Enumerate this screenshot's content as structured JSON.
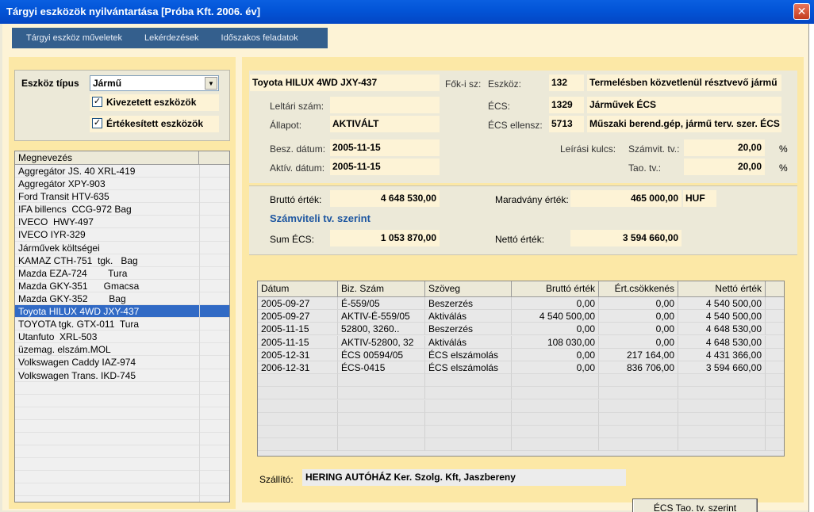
{
  "window": {
    "title": "Tárgyi eszközök nyilvántartása   [Próba Kft.    2006. év]"
  },
  "menu": [
    "Tárgyi eszköz műveletek",
    "Lekérdezések",
    "Időszakos feladatok"
  ],
  "filter": {
    "type_label": "Eszköz típus",
    "type_value": "Jármű",
    "check1_label": "Kivezetett eszközök",
    "check1_checked": true,
    "check2_label": "Értékesített eszközök",
    "check2_checked": true
  },
  "assets": {
    "header": "Megnevezés",
    "items": [
      "Aggregátor JS. 40 XRL-419",
      "Aggregátor XPY-903",
      "Ford Transit HTV-635",
      "IFA billencs  CCG-972 Bag",
      "IVECO  HWY-497",
      "IVECO IYR-329",
      "Járművek költségei",
      "KAMAZ CTH-751  tgk.   Bag",
      "Mazda EZA-724        Tura",
      "Mazda GKY-351      Gmacsa",
      "Mazda GKY-352        Bag",
      "Toyota HILUX 4WD JXY-437",
      "TOYOTA tgk. GTX-011  Tura",
      "Utanfuto  XRL-503",
      "üzemag. elszám.MOL",
      "Volkswagen Caddy IAZ-974",
      "Volkswagen Trans. IKD-745"
    ],
    "selected_index": 11
  },
  "detail": {
    "name": "Toyota HILUX 4WD JXY-437",
    "fokisz_label": "Fők-i sz:",
    "eszkoz_label": "Eszköz:",
    "eszkoz_code": "132",
    "eszkoz_text": "Termelésben közvetlenül résztvevő jármű",
    "leltari_label": "Leltári szám:",
    "leltari_value": "",
    "ecs_label": "ÉCS:",
    "ecs_code": "1329",
    "ecs_text": "Járművek ÉCS",
    "allapot_label": "Állapot:",
    "allapot_value": "AKTIVÁLT",
    "ecs_ellensz_label": "ÉCS ellensz:",
    "ecs_ellensz_code": "5713",
    "ecs_ellensz_text": "Műszaki berend.gép, jármű terv. szer. ÉCS",
    "besz_label": "Besz. dátum:",
    "besz_value": "2005-11-15",
    "aktiv_label": "Aktív. dátum:",
    "aktiv_value": "2005-11-15",
    "leirasi_label": "Leírási kulcs:",
    "szamvit_label": "Számvit. tv.:",
    "szamvit_value": "20,00",
    "tao_label": "Tao. tv.:",
    "tao_value": "20,00",
    "pct": "%"
  },
  "values": {
    "brutto_label": "Bruttó érték:",
    "brutto_value": "4 648 530,00",
    "maradvany_label": "Maradvány érték:",
    "maradvany_value": "465 000,00",
    "currency": "HUF",
    "section_title": "Számviteli tv. szerint",
    "sumecs_label": "Sum ÉCS:",
    "sumecs_value": "1 053 870,00",
    "netto_label": "Nettó érték:",
    "netto_value": "3 594 660,00"
  },
  "transactions": {
    "headers": [
      "Dátum",
      "Biz. Szám",
      "Szöveg",
      "Bruttó érték",
      "Ért.csökkenés",
      "Nettó érték"
    ],
    "rows": [
      [
        "2005-09-27",
        "É-559/05",
        "Beszerzés",
        "0,00",
        "0,00",
        "4 540 500,00"
      ],
      [
        "2005-09-27",
        "AKTIV-É-559/05",
        "Aktiválás",
        "4 540 500,00",
        "0,00",
        "4 540 500,00"
      ],
      [
        "2005-11-15",
        "52800, 3260..",
        "Beszerzés",
        "0,00",
        "0,00",
        "4 648 530,00"
      ],
      [
        "2005-11-15",
        "AKTIV-52800, 32",
        "Aktiválás",
        "108 030,00",
        "0,00",
        "4 648 530,00"
      ],
      [
        "2005-12-31",
        "ÉCS 00594/05",
        "ÉCS elszámolás",
        "0,00",
        "217 164,00",
        "4 431 366,00"
      ],
      [
        "2006-12-31",
        "ÉCS-0415",
        "ÉCS elszámolás",
        "0,00",
        "836 706,00",
        "3 594 660,00"
      ]
    ]
  },
  "supplier": {
    "label": "Szállító:",
    "value": "HERING AUTÓHÁZ Ker. Szolg. Kft, Jaszbereny"
  },
  "buttons": {
    "ecs_tao": "ÉCS Tao. tv. szerint"
  }
}
